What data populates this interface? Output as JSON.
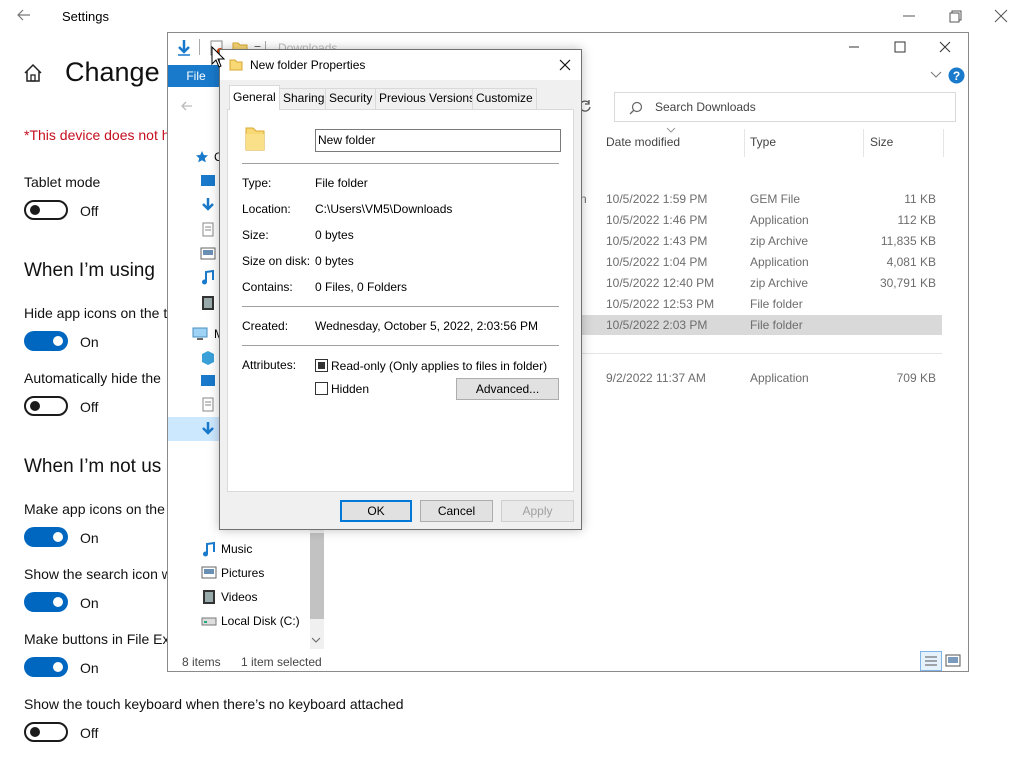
{
  "settings": {
    "window_title": "Settings",
    "heading": "Change",
    "warning": "*This device does not h",
    "items": [
      {
        "kind": "label",
        "text": "Tablet mode"
      },
      {
        "kind": "toggle",
        "state": "Off"
      },
      {
        "kind": "section",
        "text": "When I’m using"
      },
      {
        "kind": "label",
        "text": "Hide app icons on the t"
      },
      {
        "kind": "toggle",
        "state": "On"
      },
      {
        "kind": "label",
        "text": "Automatically hide the"
      },
      {
        "kind": "toggle",
        "state": "Off"
      },
      {
        "kind": "section",
        "text": "When I’m not us"
      },
      {
        "kind": "label",
        "text": "Make app icons on the"
      },
      {
        "kind": "toggle",
        "state": "On"
      },
      {
        "kind": "label",
        "text": "Show the search icon w"
      },
      {
        "kind": "toggle",
        "state": "On"
      },
      {
        "kind": "label",
        "text": "Make buttons in File Ex"
      },
      {
        "kind": "toggle",
        "state": "On"
      },
      {
        "kind": "label",
        "text": "Show the touch keyboard when there’s no keyboard attached"
      },
      {
        "kind": "toggle",
        "state": "Off"
      }
    ]
  },
  "explorer": {
    "title": "Downloads",
    "file_tab": "File",
    "search_placeholder": "Search Downloads",
    "columns": {
      "date": "Date modified",
      "type": "Type",
      "size": "Size"
    },
    "partial_name_fragment": "n",
    "rows": [
      {
        "date": "10/5/2022 1:59 PM",
        "type": "GEM File",
        "size": "11 KB",
        "selected": false
      },
      {
        "date": "10/5/2022 1:46 PM",
        "type": "Application",
        "size": "112 KB",
        "selected": false
      },
      {
        "date": "10/5/2022 1:43 PM",
        "type": "zip Archive",
        "size": "11,835 KB",
        "selected": false
      },
      {
        "date": "10/5/2022 1:04 PM",
        "type": "Application",
        "size": "4,081 KB",
        "selected": false
      },
      {
        "date": "10/5/2022 12:40 PM",
        "type": "zip Archive",
        "size": "30,791 KB",
        "selected": false
      },
      {
        "date": "10/5/2022 12:53 PM",
        "type": "File folder",
        "size": "",
        "selected": false
      },
      {
        "date": "10/5/2022 2:03 PM",
        "type": "File folder",
        "size": "",
        "selected": true
      },
      {
        "date": "9/2/2022 11:37 AM",
        "type": "Application",
        "size": "709 KB",
        "selected": false
      }
    ],
    "nav_items": [
      {
        "label": "Music",
        "icon": "music-icon"
      },
      {
        "label": "Pictures",
        "icon": "pictures-icon"
      },
      {
        "label": "Videos",
        "icon": "videos-icon"
      },
      {
        "label": "Local Disk (C:)",
        "icon": "drive-icon"
      }
    ],
    "nav_fragment_quick": "C",
    "nav_fragment_pc": "M",
    "status_items": "8 items",
    "status_selected": "1 item selected"
  },
  "dialog": {
    "title": "New folder Properties",
    "tabs": [
      "General",
      "Sharing",
      "Security",
      "Previous Versions",
      "Customize"
    ],
    "active_tab": "General",
    "name_value": "New folder",
    "properties": {
      "type_label": "Type:",
      "type_value": "File folder",
      "location_label": "Location:",
      "location_value": "C:\\Users\\VM5\\Downloads",
      "size_label": "Size:",
      "size_value": "0 bytes",
      "size_on_disk_label": "Size on disk:",
      "size_on_disk_value": "0 bytes",
      "contains_label": "Contains:",
      "contains_value": "0 Files, 0 Folders",
      "created_label": "Created:",
      "created_value": "Wednesday, October 5, 2022, 2:03:56 PM",
      "attributes_label": "Attributes:",
      "readonly_label": "Read-only (Only applies to files in folder)",
      "hidden_label": "Hidden",
      "advanced_button": "Advanced..."
    },
    "buttons": {
      "ok": "OK",
      "cancel": "Cancel",
      "apply": "Apply"
    }
  },
  "colors": {
    "accent": "#0067c0",
    "file_tab": "#1979ca",
    "warning": "#c50f1f",
    "selection": "#d9d9d9"
  }
}
